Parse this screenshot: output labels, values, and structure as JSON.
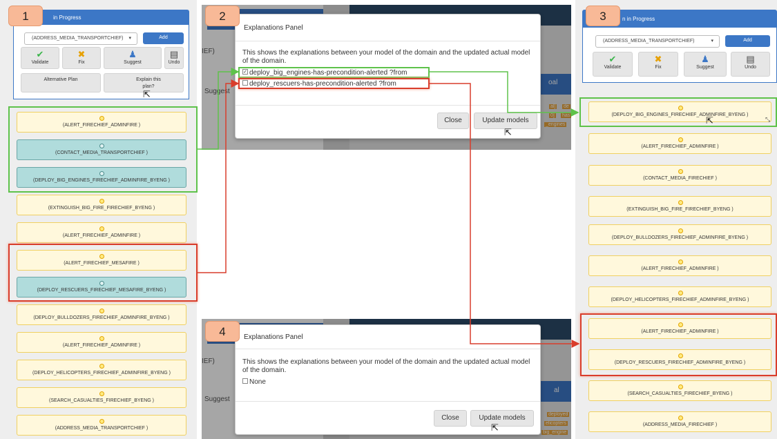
{
  "badges": [
    "1",
    "2",
    "3",
    "4"
  ],
  "panel1": {
    "header": "in Progress",
    "select_value": "(ADDRESS_MEDIA_TRANSPORTCHIEF)",
    "add": "Add",
    "tools": {
      "validate": "Validate",
      "fix": "Fix",
      "suggest": "Suggest",
      "undo": "Undo"
    },
    "alternative_plan": "Alternative Plan",
    "explain_plan": "Explain this plan?",
    "steps": [
      "(ALERT_FIRECHIEF_ADMINFIRE )",
      "(CONTACT_MEDIA_TRANSPORTCHIEF )",
      "(DEPLOY_BIG_ENGINES_FIRECHIEF_ADMINFIRE_BYENG )",
      "(EXTINGUISH_BIG_FIRE_FIRECHIEF_BYENG )",
      "(ALERT_FIRECHIEF_ADMINFIRE )",
      "(ALERT_FIRECHIEF_MESAFIRE )",
      "(DEPLOY_RESCUERS_FIRECHIEF_MESAFIRE_BYENG )",
      "(DEPLOY_BULLDOZERS_FIRECHIEF_ADMINFIRE_BYENG )",
      "(ALERT_FIRECHIEF_ADMINFIRE )",
      "(DEPLOY_HELICOPTERS_FIRECHIEF_ADMINFIRE_BYENG )",
      "(SEARCH_CASUALTIES_FIRECHIEF_BYENG )",
      "(ADDRESS_MEDIA_TRANSPORTCHIEF )"
    ]
  },
  "modal2": {
    "title": "Explanations Panel",
    "description": "This shows the explanations between your model of the domain and the updated actual model of the domain.",
    "options": [
      {
        "label": "deploy_big_engines-has-precondition-alerted ?from",
        "checked": true
      },
      {
        "label": "deploy_rescuers-has-precondition-alerted ?from",
        "checked": false
      }
    ],
    "close": "Close",
    "update": "Update models",
    "bg_left_text": "IEF)",
    "bg_suggest": "Suggest",
    "bg_goal": "oal",
    "bg_tags": [
      "al]",
      "de",
      "0]",
      "has",
      "_engines"
    ]
  },
  "panel3": {
    "header": "n in Progress",
    "select_value": "(ADDRESS_MEDIA_TRANSPORTCHIEF)",
    "add": "Add",
    "tools": {
      "validate": "Validate",
      "fix": "Fix",
      "suggest": "Suggest",
      "undo": "Undo"
    },
    "steps": [
      "(DEPLOY_BIG_ENGINES_FIRECHIEF_ADMINFIRE_BYENG )",
      "(ALERT_FIRECHIEF_ADMINFIRE )",
      "(CONTACT_MEDIA_FIRECHIEF )",
      "(EXTINGUISH_BIG_FIRE_FIRECHIEF_BYENG )",
      "(DEPLOY_BULLDOZERS_FIRECHIEF_ADMINFIRE_BYENG )",
      "(ALERT_FIRECHIEF_ADMINFIRE )",
      "(DEPLOY_HELICOPTERS_FIRECHIEF_ADMINFIRE_BYENG )",
      "(ALERT_FIRECHIEF_ADMINFIRE )",
      "(DEPLOY_RESCUERS_FIRECHIEF_ADMINFIRE_BYENG )",
      "(SEARCH_CASUALTIES_FIRECHIEF_BYENG )",
      "(ADDRESS_MEDIA_FIRECHIEF )"
    ]
  },
  "modal4": {
    "title": "Explanations Panel",
    "description": "This shows the explanations between your model of the domain and the updated actual model of the domain.",
    "options": [
      {
        "label": "None",
        "checked": false
      }
    ],
    "close": "Close",
    "update": "Update models",
    "bg_left_text": "IEF)",
    "bg_suggest": "Suggest",
    "bg_goal": "al",
    "bg_tags": [
      "deployed",
      "elicopters",
      "big_engine"
    ]
  },
  "colors": {
    "header_blue": "#3c77c6",
    "step_yellow": "#fff8dc",
    "step_teal": "#b0dcdc",
    "highlight_green": "#5ec24a",
    "highlight_red": "#d93d2b",
    "badge_orange": "#f8b997"
  }
}
